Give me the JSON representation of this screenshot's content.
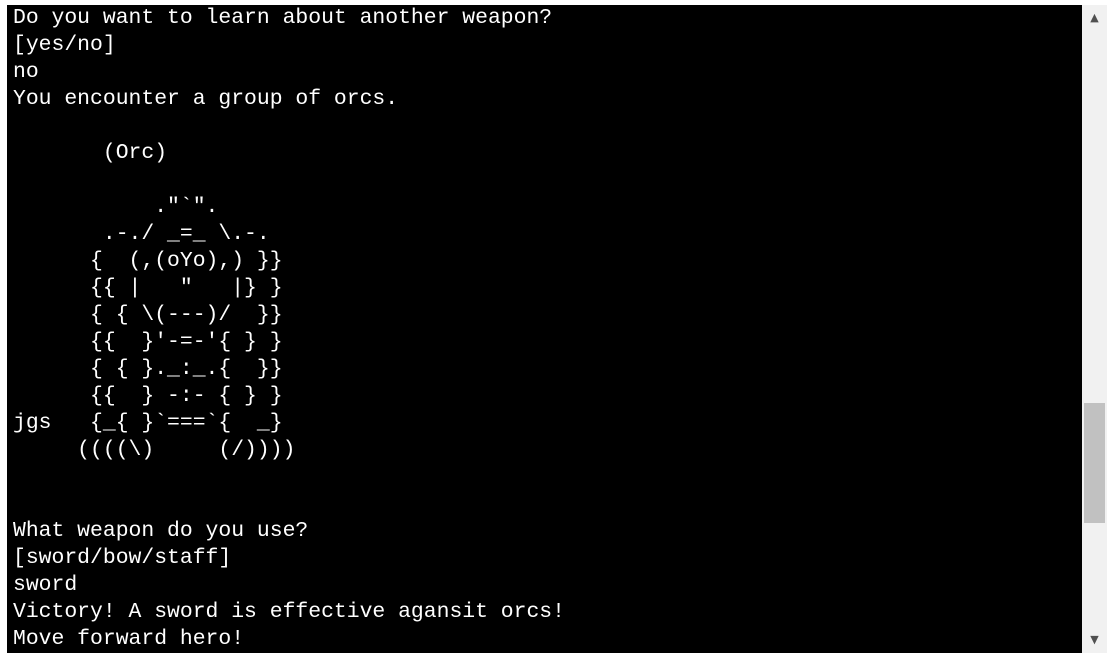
{
  "terminal": {
    "lines": [
      "Do you want to learn about another weapon?",
      "[yes/no]",
      "no",
      "You encounter a group of orcs.",
      "",
      "       (Orc)",
      "",
      "           .\"`\".",
      "       .-./ _=_ \\.-.",
      "      {  (,(oYo),) }}",
      "      {{ |   \"   |} }",
      "      { { \\(---)/  }}",
      "      {{  }'-=-'{ } }",
      "      { { }._:_.{  }}",
      "      {{  } -:- { } }",
      "jgs   {_{ }`===`{  _}",
      "     ((((\\)     (/))))",
      "",
      "",
      "What weapon do you use?",
      "[sword/bow/staff]",
      "sword",
      "Victory! A sword is effective agansit orcs!",
      "Move forward hero!"
    ]
  },
  "scrollbar": {
    "up_icon": "chevron-up-icon",
    "down_icon": "chevron-down-icon",
    "up_glyph": "▲",
    "down_glyph": "▼",
    "thumb_color": "#c1c1c1",
    "track_color": "#f1f1f1"
  },
  "colors": {
    "terminal_background": "#000000",
    "terminal_text": "#ffffff"
  }
}
